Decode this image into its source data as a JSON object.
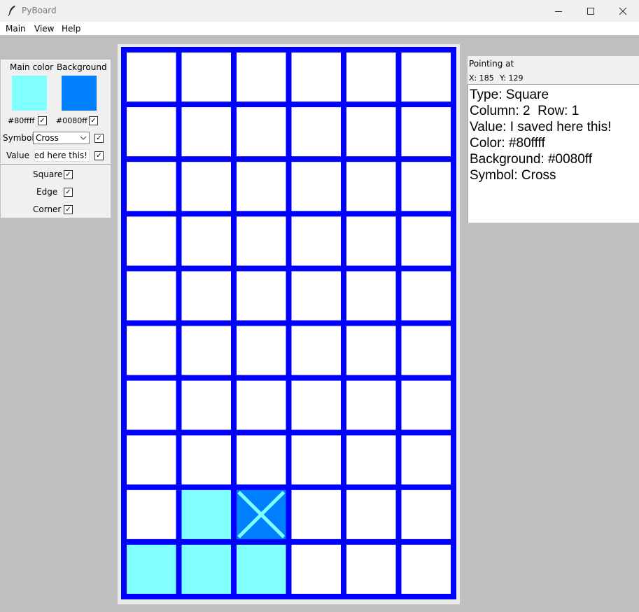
{
  "window": {
    "title": "PyBoard",
    "icon": "feather-icon"
  },
  "menu": {
    "main": "Main",
    "view": "View",
    "help": "Help"
  },
  "left_panel": {
    "main_color_label": "Main color",
    "background_label": "Background",
    "main_color_hex": "#80ffff",
    "background_hex": "#0080ff",
    "main_color_checked": true,
    "background_checked": true,
    "symbol_label": "Symbol",
    "symbol_value": "Cross",
    "symbol_checked": true,
    "value_label": "Value",
    "value_text": "ved here this!",
    "value_checked": true,
    "square_label": "Square",
    "square_checked": true,
    "edge_label": "Edge",
    "edge_checked": true,
    "corner_label": "Corner",
    "corner_checked": true
  },
  "info_panel": {
    "title": "Pointing at",
    "x_label": "X: 185",
    "y_label": "Y: 129",
    "type_line": "Type: Square",
    "position_line": "Column: 2  Row: 1",
    "value_line": "Value: I saved here this!",
    "color_line": "Color: #80ffff",
    "background_line": "Background: #0080ff",
    "symbol_line": "Symbol: Cross"
  },
  "board": {
    "columns": 6,
    "rows": 10,
    "grid_color": "#0000ff",
    "empty_color": "#ffffff",
    "colored_cells": [
      {
        "col": 1,
        "row": 8,
        "fill": "#80ffff"
      },
      {
        "col": 2,
        "row": 8,
        "fill": "#0080ff",
        "symbol": "cross",
        "symbol_color": "#80ffff"
      },
      {
        "col": 0,
        "row": 9,
        "fill": "#80ffff"
      },
      {
        "col": 1,
        "row": 9,
        "fill": "#80ffff"
      },
      {
        "col": 2,
        "row": 9,
        "fill": "#80ffff"
      }
    ]
  }
}
